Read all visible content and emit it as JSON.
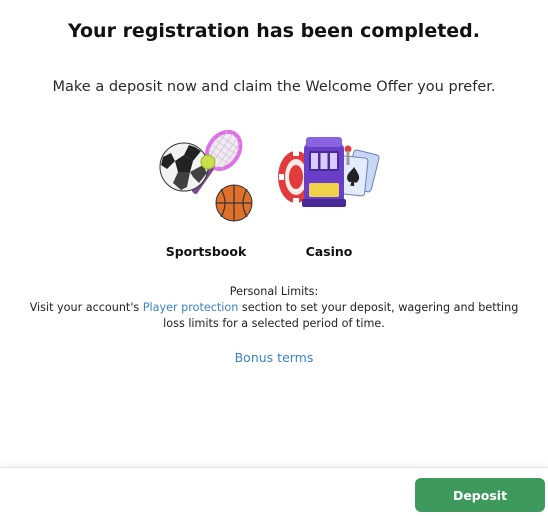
{
  "header": {
    "title": "Your registration has been completed.",
    "subtitle": "Make a deposit now and claim the Welcome Offer you prefer."
  },
  "offers": [
    {
      "label": "Sportsbook",
      "icon": "sports-balls-icon"
    },
    {
      "label": "Casino",
      "icon": "slot-machine-icon"
    }
  ],
  "limits": {
    "heading": "Personal Limits:",
    "text_before_link": "Visit your account's ",
    "link_label": "Player protection",
    "text_after_link": " section to set your deposit, wagering and betting loss limits for a selected period of time."
  },
  "bonus_terms_label": "Bonus terms",
  "footer": {
    "deposit_label": "Deposit"
  },
  "colors": {
    "accent_green": "#3d9a5c",
    "link_blue": "#3a82c9"
  }
}
